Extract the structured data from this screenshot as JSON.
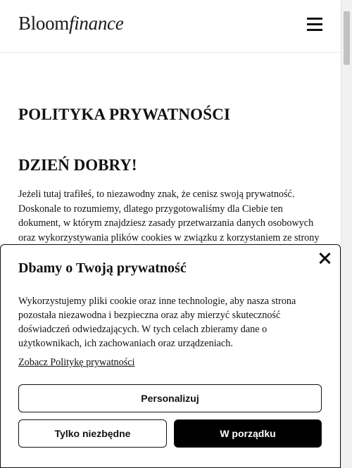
{
  "header": {
    "logo_brand": "Bloom",
    "logo_italic": "finance"
  },
  "page": {
    "title": "POLITYKA PRYWATNOŚCI",
    "greeting": "DZIEŃ DOBRY!",
    "intro": "Jeżeli tutaj trafiłeś, to niezawodny znak, że cenisz swoją prywatność. Doskonale to rozumiemy, dlatego przygotowaliśmy dla Ciebie ten dokument, w którym znajdziesz zasady przetwarzania danych osobowych oraz wykorzystywania plików cookies w związku z korzystaniem ze strony"
  },
  "consent": {
    "title": "Dbamy o Twoją prywatność",
    "text": "Wykorzystujemy pliki cookie oraz inne technologie, aby nasza strona pozostała niezawodna i bezpieczna oraz aby mierzyć skuteczność doświadczeń odwiedzających. W tych celach zbieramy dane o użytkownikach, ich zachowaniach oraz urządzeniach.",
    "policy_link": "Zobacz Politykę prywatności",
    "personalize_label": "Personalizuj",
    "necessary_label": "Tylko niezbędne",
    "accept_label": "W porządku"
  },
  "icons": {
    "menu": "hamburger-menu-icon",
    "close": "close-icon"
  }
}
